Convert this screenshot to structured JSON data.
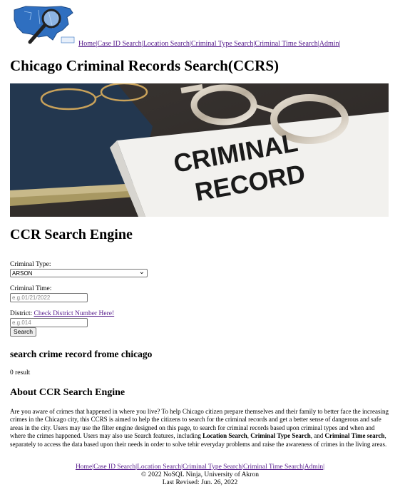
{
  "nav": {
    "items": [
      "Home",
      "Case ID Search",
      "Location Search",
      "Criminal Type Search",
      "Criminal Time Search",
      "Admin"
    ]
  },
  "site": {
    "title": "Chicago Criminal Records Search(CCRS)"
  },
  "hero": {
    "image_text_line1": "CRIMINAL",
    "image_text_line2": "RECORD"
  },
  "engine": {
    "title": "CCR Search Engine",
    "criminal_type_label": "Criminal Type:",
    "criminal_type_value": "ARSON",
    "criminal_time_label": "Criminal Time:",
    "criminal_time_placeholder": "e.g.01/21/2022",
    "district_label": "District:",
    "district_link": "Check District Number Here!",
    "district_placeholder": "e.g.014",
    "search_button": "Search"
  },
  "results": {
    "title": "search crime record frome chicago",
    "count": "0 result"
  },
  "about": {
    "title": "About CCR Search Engine",
    "p1": "Are you aware of crimes that happened in where you live? To help Chicago citizen prepare themselves and their family to better face the increasing crimes in the Chicago city, this CCRS is aimed to help the citizens to search for the criminal records and get a better sense of dangerous and safe areas in the city. Users may use the filter engine designed on this page, to search for criminal records based upon criminal types and when and where the crimes happened. Users may also use Search features, including ",
    "b1": "Location Search",
    "p2": ", ",
    "b2": "Criminal Type Search",
    "p3": ", and ",
    "b3": "Criminal Time search",
    "p4": ", separately to access the data based upon their needs in order to solve tehir everyday problems and raise the awareness of crimes in the living areas."
  },
  "footer": {
    "copyright": "© 2022 NoSQL Ninja, University of Akron",
    "last_revised": "Last Revised: Jun. 26, 2022"
  },
  "colors": {
    "link": "#551a8b",
    "logo_map": "#2f6fc0"
  }
}
